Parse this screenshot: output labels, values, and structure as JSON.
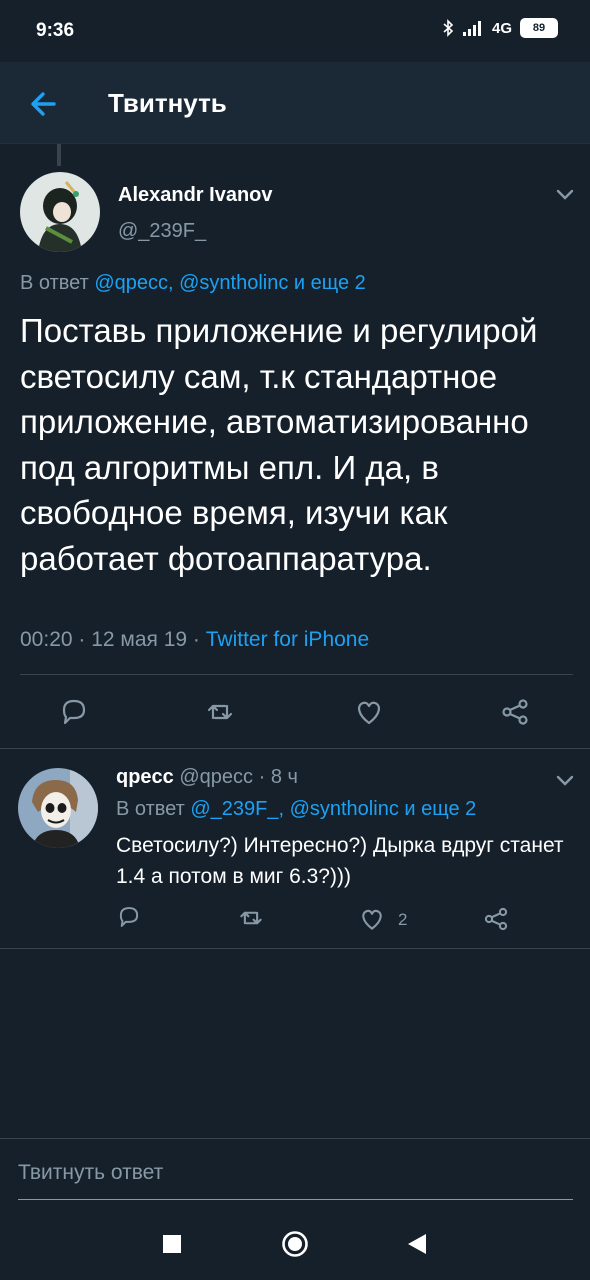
{
  "status_bar": {
    "time": "9:36",
    "network": "4G",
    "battery": "89"
  },
  "header": {
    "title": "Твитнуть"
  },
  "main_tweet": {
    "author_name": "Alexandr Ivanov",
    "author_handle": "@_239F_",
    "reply_prefix": "В ответ",
    "reply_mentions": "@qpecc, @syntholinc и еще 2",
    "text": "Поставь приложение и регулирой светосилу сам, т.к стандартное приложение, автоматизированно под алгоритмы епл. И да, в свободное время, изучи как работает фотоаппаратура.",
    "timestamp": "00:20 · 12 мая 19 · ",
    "source": "Twitter for iPhone"
  },
  "reply_tweet": {
    "author_name": "qpecc",
    "author_handle": "@qpecc · 8 ч",
    "reply_prefix": "В ответ",
    "reply_mentions": "@_239F_, @syntholinc и еще 2",
    "text": "Светосилу?) Интересно?) Дырка вдруг станет 1.4 а потом в миг 6.3?)))",
    "like_count": "2"
  },
  "compose": {
    "placeholder": "Твитнуть ответ"
  },
  "icons": {
    "back": "arrow-left-icon",
    "chevron": "chevron-down-icon",
    "reply": "reply-icon",
    "retweet": "retweet-icon",
    "like": "heart-icon",
    "share": "share-icon"
  },
  "colors": {
    "background": "#15202b",
    "accent": "#1da1f2",
    "secondary_text": "#8899a6",
    "divider": "#38444d"
  }
}
